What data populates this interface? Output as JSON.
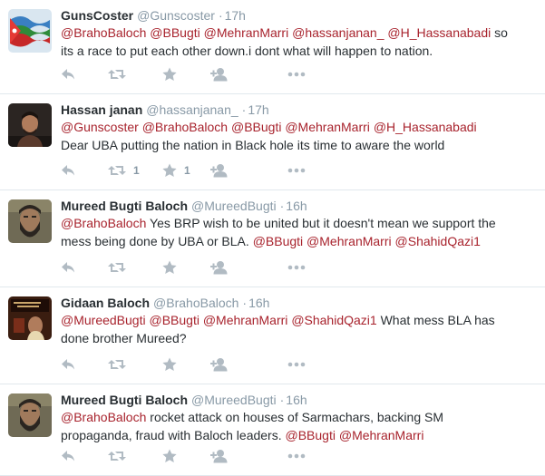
{
  "tweets": [
    {
      "name": "GunsCoster",
      "handle": "@Gunscoster",
      "separator": "·",
      "time": "17h",
      "line1": [
        {
          "t": "@BrahoBaloch",
          "m": true
        },
        {
          "t": " ",
          "m": false
        },
        {
          "t": "@BBugti",
          "m": true
        },
        {
          "t": " ",
          "m": false
        },
        {
          "t": "@MehranMarri",
          "m": true
        },
        {
          "t": " ",
          "m": false
        },
        {
          "t": "@hassanjanan_",
          "m": true
        },
        {
          "t": " ",
          "m": false
        },
        {
          "t": "@H_Hassanabadi",
          "m": true
        },
        {
          "t": " so",
          "m": false
        }
      ],
      "line2": [
        {
          "t": "its a race to put each other down.i dont what will happen to nation.",
          "m": false
        }
      ],
      "retweet_count": "",
      "favorite_count": "",
      "avatar": "flag-avatar"
    },
    {
      "name": "Hassan janan",
      "handle": "@hassanjanan_",
      "separator": "·",
      "time": "17h",
      "line1": [
        {
          "t": "@Gunscoster",
          "m": true
        },
        {
          "t": " ",
          "m": false
        },
        {
          "t": "@BrahoBaloch",
          "m": true
        },
        {
          "t": " ",
          "m": false
        },
        {
          "t": "@BBugti",
          "m": true
        },
        {
          "t": " ",
          "m": false
        },
        {
          "t": "@MehranMarri",
          "m": true
        },
        {
          "t": " ",
          "m": false
        },
        {
          "t": "@H_Hassanabadi",
          "m": true
        }
      ],
      "line2": [
        {
          "t": "Dear UBA putting the nation in Black hole its time to aware the world",
          "m": false
        }
      ],
      "retweet_count": "1",
      "favorite_count": "1",
      "avatar": "man-dark-avatar"
    },
    {
      "name": "Mureed Bugti Baloch",
      "handle": "@MureedBugti",
      "separator": "·",
      "time": "16h",
      "line1": [
        {
          "t": "@BrahoBaloch",
          "m": true
        },
        {
          "t": " Yes BRP wish to be united but it doesn't mean we support the",
          "m": false
        }
      ],
      "line2": [
        {
          "t": "mess being done by UBA or BLA. ",
          "m": false
        },
        {
          "t": "@BBugti",
          "m": true
        },
        {
          "t": " ",
          "m": false
        },
        {
          "t": "@MehranMarri",
          "m": true
        },
        {
          "t": " ",
          "m": false
        },
        {
          "t": "@ShahidQazi1",
          "m": true
        }
      ],
      "retweet_count": "",
      "favorite_count": "",
      "avatar": "bearded-man-avatar"
    },
    {
      "name": "Gidaan Baloch",
      "handle": "@BrahoBaloch",
      "separator": "·",
      "time": "16h",
      "line1": [
        {
          "t": "@MureedBugti",
          "m": true
        },
        {
          "t": " ",
          "m": false
        },
        {
          "t": "@BBugti",
          "m": true
        },
        {
          "t": " ",
          "m": false
        },
        {
          "t": "@MehranMarri",
          "m": true
        },
        {
          "t": " ",
          "m": false
        },
        {
          "t": "@ShahidQazi1",
          "m": true
        },
        {
          "t": " What mess BLA has",
          "m": false
        }
      ],
      "line2": [
        {
          "t": "done brother Mureed?",
          "m": false
        }
      ],
      "retweet_count": "",
      "favorite_count": "",
      "avatar": "poster-avatar"
    },
    {
      "name": "Mureed Bugti Baloch",
      "handle": "@MureedBugti",
      "separator": "·",
      "time": "16h",
      "line1": [
        {
          "t": "@BrahoBaloch",
          "m": true
        },
        {
          "t": " rocket attack on houses of Sarmachars, backing SM",
          "m": false
        }
      ],
      "line2": [
        {
          "t": "propaganda, fraud with Baloch leaders. ",
          "m": false
        },
        {
          "t": "@BBugti",
          "m": true
        },
        {
          "t": " ",
          "m": false
        },
        {
          "t": "@MehranMarri",
          "m": true
        }
      ],
      "retweet_count": "",
      "favorite_count": "",
      "avatar": "bearded-man-avatar"
    }
  ],
  "colors": {
    "mention": "#a8232d",
    "meta": "#8899a6",
    "icon": "#b1bbc3",
    "divider": "#e1e8ed"
  },
  "icons": [
    "reply-icon",
    "retweet-icon",
    "favorite-icon",
    "follow-icon",
    "more-icon"
  ]
}
